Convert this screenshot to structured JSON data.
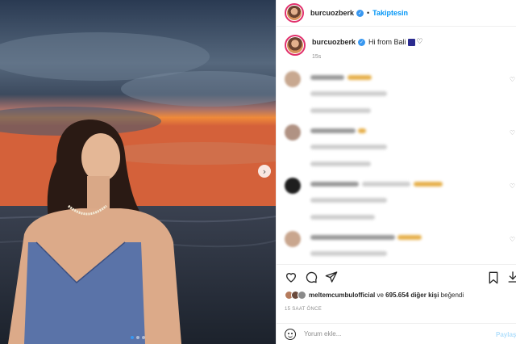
{
  "post": {
    "username": "burcuozberk",
    "follow_label": "Takiptesin",
    "separator": "•",
    "caption": "Hi from Bali",
    "caption_time": "15s",
    "carousel_next_icon": "chevron-right-icon"
  },
  "likes": {
    "liked_by": "meltemcumbulofficial",
    "connector": "ve",
    "count_text": "695.654 diğer kişi",
    "suffix": "beğendi"
  },
  "time_ago": "15 SAAT ÖNCE",
  "comment_input": {
    "placeholder": "Yorum ekle...",
    "post_label": "Paylaş"
  },
  "icons": {
    "like": "heart-icon",
    "comment": "comment-icon",
    "share": "share-icon",
    "save": "bookmark-icon",
    "download": "download-icon",
    "emoji": "smile-icon"
  },
  "colors": {
    "accent": "#0095f6",
    "verified": "#3897f0",
    "story_ring": "#e1306c"
  }
}
